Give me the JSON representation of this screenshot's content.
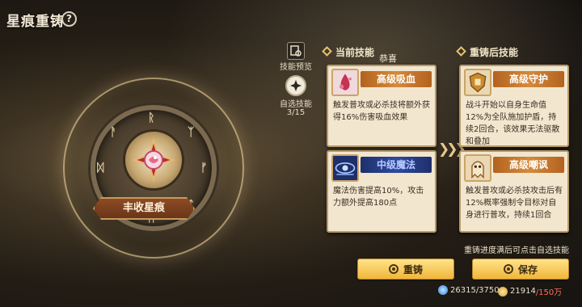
{
  "title": "星痕重铸",
  "help_symbol": "?",
  "medallion": {
    "ribbon_label": "丰收星痕",
    "runes": [
      "ᚱ",
      "ᛉ",
      "ᚠ",
      "ᛏ",
      "ᛗ",
      "ᛚ",
      "ᛞ",
      "ᚨ"
    ]
  },
  "side": {
    "preview_label": "技能预览",
    "select_label": "自选技能",
    "select_count": "3/15"
  },
  "current": {
    "header": "当前技能",
    "badge": "恭喜",
    "skills": [
      {
        "name": "高级吸血",
        "desc": "触发普攻或必杀技将额外获得16%伤害吸血效果",
        "tier": "orange"
      },
      {
        "name": "中级魔法",
        "desc": "魔法伤害提高10%，攻击力额外提高180点",
        "tier": "blue"
      }
    ]
  },
  "after": {
    "header": "重铸后技能",
    "skills": [
      {
        "name": "高级守护",
        "desc": "战斗开始以自身生命值12%为全队施加护盾，持续2回合，该效果无法驱散和叠加",
        "tier": "orange"
      },
      {
        "name": "高级嘲讽",
        "desc": "触发普攻或必杀技攻击后有12%概率强制令目标对自身进行普攻，持续1回合",
        "tier": "orange"
      }
    ]
  },
  "arrows": "❯❯❯",
  "tip": "重铸进度满后可点击自选技能",
  "buttons": {
    "reforge": "重铸",
    "save": "保存"
  },
  "currency": {
    "gem_current": "26315",
    "gem_required": "/3750",
    "gold_current": "21914",
    "gold_required": "/150万"
  },
  "colors": {
    "accent": "#f0b63a",
    "card_bg": "#f2e6cf",
    "tier_orange": "#d48a3b",
    "tier_blue": "#2d4aa0"
  }
}
